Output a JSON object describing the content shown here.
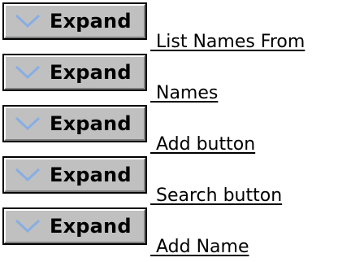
{
  "items": [
    {
      "button_label": "Expand",
      "icon": "chevron-down-icon",
      "link_text": " List Names From"
    },
    {
      "button_label": "Expand",
      "icon": "chevron-down-icon",
      "link_text": " Names"
    },
    {
      "button_label": "Expand",
      "icon": "chevron-down-icon",
      "link_text": " Add button"
    },
    {
      "button_label": "Expand",
      "icon": "chevron-down-icon",
      "link_text": " Search button"
    },
    {
      "button_label": "Expand",
      "icon": "chevron-down-icon",
      "link_text": " Add Name"
    }
  ],
  "colors": {
    "button_face": "#c0c0c0",
    "chevron": "#87aee4",
    "link": "#000000"
  }
}
